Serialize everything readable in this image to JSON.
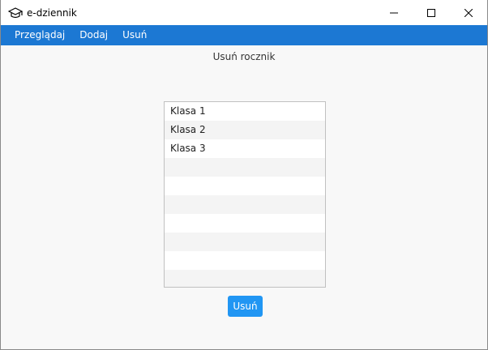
{
  "window": {
    "title": "e-dziennik",
    "icon": "graduation-cap-icon",
    "controls": [
      "minimize-icon",
      "maximize-icon",
      "close-icon"
    ]
  },
  "menu": {
    "items": [
      "Przeglądaj",
      "Dodaj",
      "Usuń"
    ]
  },
  "main": {
    "title": "Usuń rocznik",
    "list": {
      "items": [
        "Klasa 1",
        "Klasa 2",
        "Klasa 3",
        "",
        "",
        "",
        "",
        "",
        "",
        ""
      ]
    },
    "delete_button_label": "Usuń"
  },
  "colors": {
    "menubar": "#1c78d3",
    "button": "#2196f3",
    "background": "#f8f8f8"
  }
}
